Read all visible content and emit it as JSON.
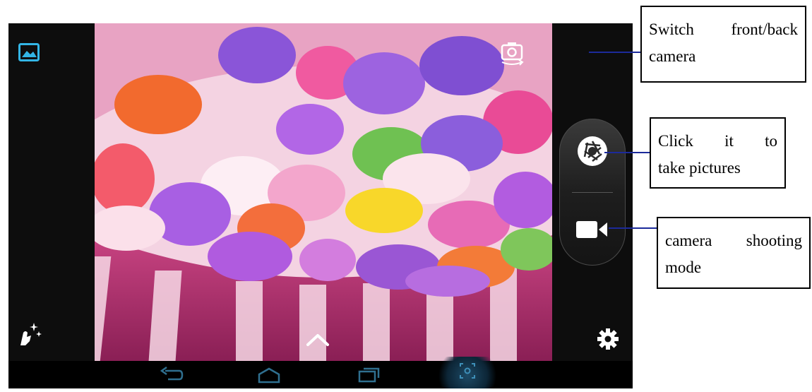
{
  "callouts": {
    "switch_camera": {
      "line1": "Switch  front/back",
      "line2": "camera"
    },
    "take_picture": {
      "line1": "Click   it   to",
      "line2": "take pictures"
    },
    "shooting_mode": {
      "line1": "camera   shooting",
      "line2": "mode"
    }
  },
  "icons": {
    "gallery": "gallery-thumbnail-icon",
    "effects": "effects-wand-icon",
    "switch": "camera-switch-icon",
    "shutter": "shutter-aperture-icon",
    "video": "video-camera-icon",
    "expand": "chevron-up-icon",
    "settings": "gear-icon",
    "back": "back-arrow-icon",
    "home": "home-icon",
    "recent": "recent-apps-icon",
    "screenshot": "screenshot-icon"
  },
  "colors": {
    "accent": "#33b5e5",
    "leader": "#1c2a9a",
    "device_bg": "#0b0b0b"
  }
}
